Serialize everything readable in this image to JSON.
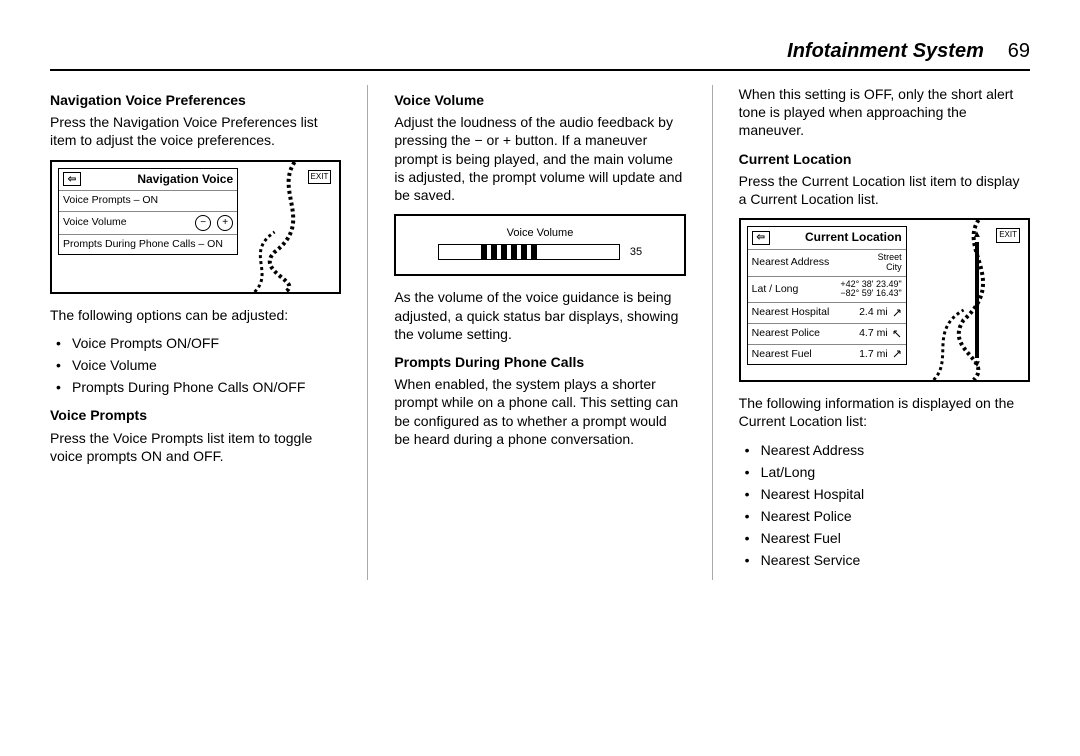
{
  "header": {
    "title": "Infotainment System",
    "page": "69"
  },
  "col1": {
    "h1": "Navigation Voice Preferences",
    "p1": "Press the Navigation Voice Preferences list item to adjust the voice preferences.",
    "fig1": {
      "title": "Navigation Voice",
      "row1": "Voice Prompts – ON",
      "row2_label": "Voice Volume",
      "row3": "Prompts During Phone Calls – ON",
      "exit": "EXIT"
    },
    "p2": "The following options can be adjusted:",
    "li1": "Voice Prompts ON/OFF",
    "li2": "Voice Volume",
    "li3": "Prompts During Phone Calls ON/OFF",
    "h2": "Voice Prompts",
    "p3": "Press the Voice Prompts list item to toggle voice prompts ON and OFF."
  },
  "col2": {
    "h1": "Voice Volume",
    "p1": "Adjust the loudness of the audio feedback by pressing the − or + button. If a maneuver prompt is being played, and the main volume is adjusted, the prompt volume will update and be saved.",
    "fig2": {
      "title": "Voice Volume",
      "value": "35"
    },
    "p2": "As the volume of the voice guidance is being adjusted, a quick status bar displays, showing the volume setting.",
    "h2": "Prompts During Phone Calls",
    "p3": "When enabled, the system plays a shorter prompt while on a phone call. This setting can be configured as to whether a prompt would be heard during a phone conversation."
  },
  "col3": {
    "p0": "When this setting is OFF, only the short alert tone is played when approaching the maneuver.",
    "h1": "Current Location",
    "p1": "Press the Current Location list item to display a Current Location list.",
    "fig3": {
      "title": "Current Location",
      "exit": "EXIT",
      "r1_label": "Nearest Address",
      "r1_v1": "Street",
      "r1_v2": "City",
      "r2_label": "Lat / Long",
      "r2_v1": "+42° 38' 23.49\"",
      "r2_v2": "−82° 59' 16.43\"",
      "r3_label": "Nearest Hospital",
      "r3_v": "2.4 mi",
      "r4_label": "Nearest Police",
      "r4_v": "4.7 mi",
      "r5_label": "Nearest Fuel",
      "r5_v": "1.7 mi"
    },
    "p2": "The following information is displayed on the Current Location list:",
    "li1": "Nearest Address",
    "li2": "Lat/Long",
    "li3": "Nearest Hospital",
    "li4": "Nearest Police",
    "li5": "Nearest Fuel",
    "li6": "Nearest Service"
  }
}
